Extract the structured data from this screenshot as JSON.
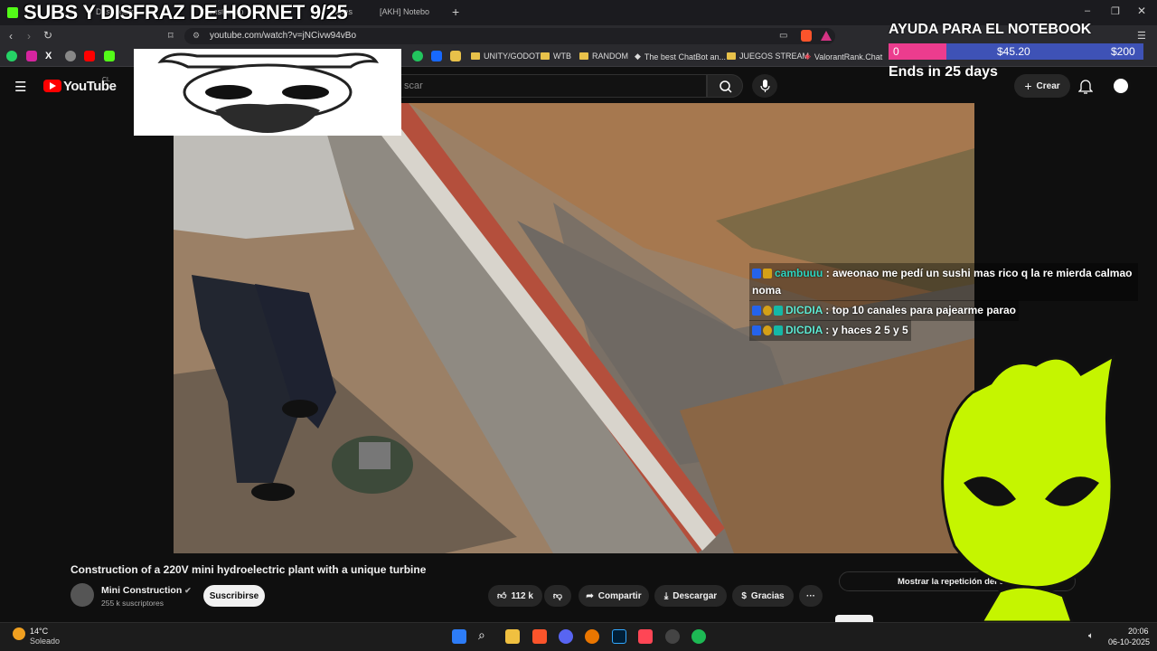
{
  "overlay": {
    "title": "SUBS Y DISFRAZ DE HORNET 9/25",
    "goal_title": "AYUDA PARA EL NOTEBOOK",
    "goal_start": "0",
    "goal_current": "$45.20",
    "goal_target": "$200",
    "goal_progress": 0.226,
    "goal_ends": "Ends in 25 days"
  },
  "browser": {
    "tabs": [
      "Dashboard",
      "Constructio",
      "notas",
      "[AKH] Notebo"
    ],
    "new_tab": "+",
    "url": "youtube.com/watch?v=jNCivw94vBo",
    "bookmarks": [
      "UNITY/GODOT",
      "WTB",
      "RANDOM",
      "The best ChatBot an...",
      "JUEGOS STREAM",
      "ValorantRank.Chat"
    ]
  },
  "youtube": {
    "brand": "YouTube",
    "region": "CL",
    "search_placeholder": "scar",
    "create_label": "Crear"
  },
  "video": {
    "title": "Construction of a 220V mini hydroelectric plant with a unique turbine",
    "channel": "Mini Construction",
    "subscribers": "255 k suscriptores",
    "subscribe_label": "Suscribirse",
    "likes": "112 k",
    "share_label": "Compartir",
    "download_label": "Descargar",
    "thanks_label": "Gracias",
    "more_label": "···",
    "chat_replay_label": "Mostrar la repetición del chat"
  },
  "chat": [
    {
      "user": "cambuuu",
      "user_color": "#2dd4bf",
      "message": ": aweonao me pedí un sushi mas rico q la re mierda calmao",
      "message_cont": "noma"
    },
    {
      "user": "DICDIA",
      "user_color": "#5eead4",
      "message": ": top 10 canales para pajearme parao"
    },
    {
      "user": "DICDIA",
      "user_color": "#5eead4",
      "message": ": y haces 2 5 y 5"
    }
  ],
  "taskbar": {
    "temperature": "14°C",
    "weather": "Soleado",
    "time": "20:06",
    "date": "06-10-2025"
  },
  "colors": {
    "youtube_red": "#ff0000",
    "goal_bar": "#3e52b6",
    "goal_fill": "#ec3c8e",
    "mascot_green": "#c5f500"
  }
}
